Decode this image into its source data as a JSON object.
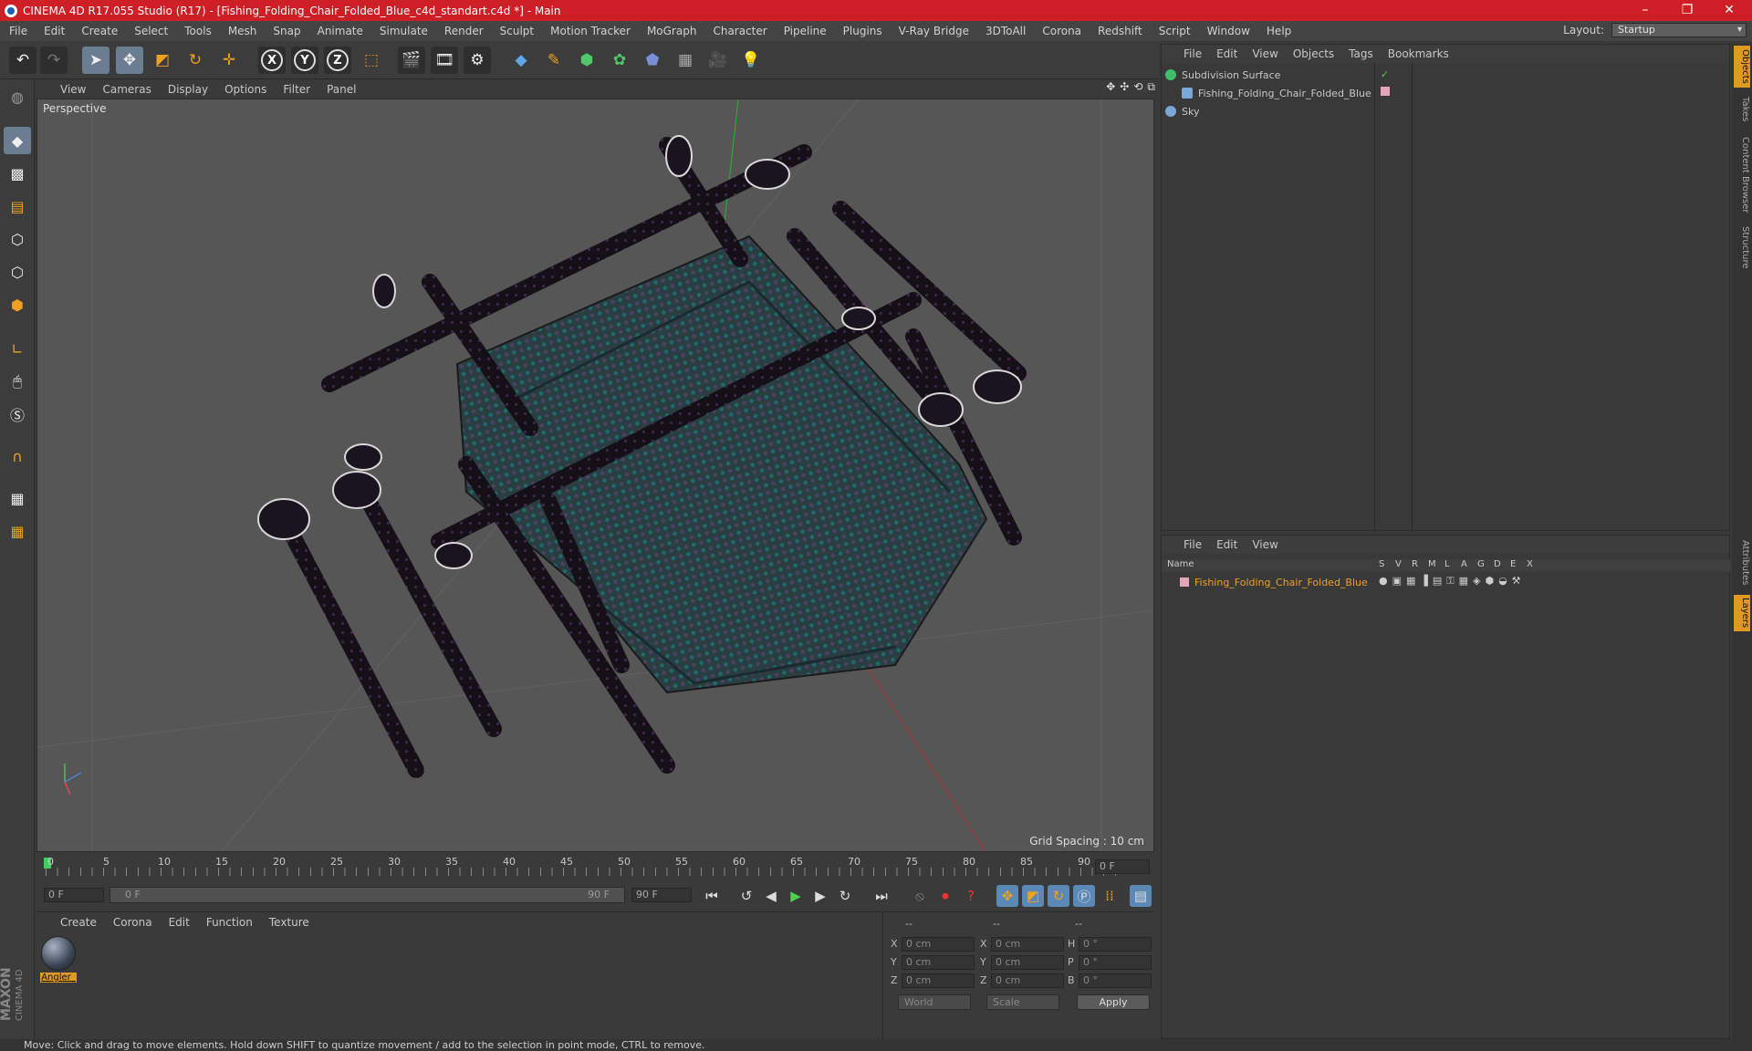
{
  "window": {
    "title": "CINEMA 4D R17.055 Studio (R17) - [Fishing_Folding_Chair_Folded_Blue_c4d_standart.c4d *] - Main"
  },
  "menubar": [
    "File",
    "Edit",
    "Create",
    "Select",
    "Tools",
    "Mesh",
    "Snap",
    "Animate",
    "Simulate",
    "Render",
    "Sculpt",
    "Motion Tracker",
    "MoGraph",
    "Character",
    "Pipeline",
    "Plugins",
    "V-Ray Bridge",
    "3DToAll",
    "Corona",
    "Redshift",
    "Script",
    "Window",
    "Help"
  ],
  "layout": {
    "label": "Layout:",
    "value": "Startup"
  },
  "toolbar": {
    "axis_x": "X",
    "axis_y": "Y",
    "axis_z": "Z"
  },
  "viewport": {
    "menu": [
      "View",
      "Cameras",
      "Display",
      "Options",
      "Filter",
      "Panel"
    ],
    "label": "Perspective",
    "grid_spacing": "Grid Spacing : 10 cm"
  },
  "timeline": {
    "ticks": [
      "0",
      "5",
      "10",
      "15",
      "20",
      "25",
      "30",
      "35",
      "40",
      "45",
      "50",
      "55",
      "60",
      "65",
      "70",
      "75",
      "80",
      "85",
      "90"
    ],
    "current_frame": "0 F",
    "start_field": "0 F",
    "range_start": "0 F",
    "range_end": "90 F",
    "end_field": "90 F"
  },
  "material_panel": {
    "menu": [
      "Create",
      "Corona",
      "Edit",
      "Function",
      "Texture"
    ],
    "material_name": "Angler_"
  },
  "coords": {
    "header": [
      "--",
      "--",
      "--"
    ],
    "rows": [
      {
        "a": "X",
        "v1": "0 cm",
        "b": "X",
        "v2": "0 cm",
        "c": "H",
        "v3": "0 °"
      },
      {
        "a": "Y",
        "v1": "0 cm",
        "b": "Y",
        "v2": "0 cm",
        "c": "P",
        "v3": "0 °"
      },
      {
        "a": "Z",
        "v1": "0 cm",
        "b": "Z",
        "v2": "0 cm",
        "c": "B",
        "v3": "0 °"
      }
    ],
    "mode": "World",
    "transform": "Scale",
    "apply": "Apply"
  },
  "objects_panel": {
    "menu": [
      "File",
      "Edit",
      "View",
      "Objects",
      "Tags",
      "Bookmarks"
    ],
    "items": [
      {
        "name": "Subdivision Surface",
        "color": "#3fbf6a"
      },
      {
        "name": "Fishing_Folding_Chair_Folded_Blue",
        "color": "#7aa7d8"
      },
      {
        "name": "Sky",
        "color": "#7aa7d8"
      }
    ]
  },
  "layers_panel": {
    "menu": [
      "File",
      "Edit",
      "View"
    ],
    "columns": [
      "Name",
      "S",
      "V",
      "R",
      "M",
      "L",
      "A",
      "G",
      "D",
      "E",
      "X"
    ],
    "layer_name": "Fishing_Folding_Chair_Folded_Blue"
  },
  "side_tabs": [
    "Objects",
    "Takes",
    "Content Browser",
    "Structure",
    "Attributes",
    "Layers"
  ],
  "status": "Move: Click and drag to move elements. Hold down SHIFT to quantize movement / add to the selection in point mode, CTRL to remove.",
  "brand": {
    "maxon": "MAXON",
    "c4d": "CINEMA 4D"
  },
  "colors": {
    "title_bar": "#ce1e26",
    "accent": "#e09a22",
    "active_tool": "#6a7d91"
  }
}
